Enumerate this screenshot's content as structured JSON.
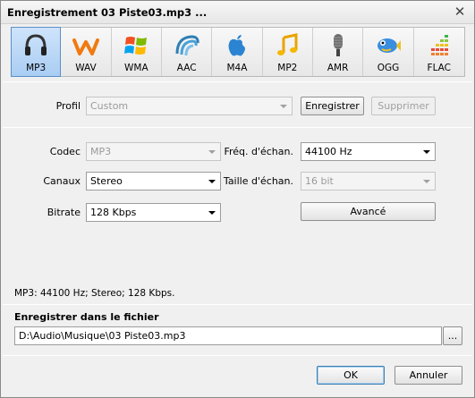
{
  "window": {
    "title": "Enregistrement 03 Piste03.mp3 ...",
    "close_glyph": "✕"
  },
  "formats": [
    {
      "label": "MP3",
      "icon": "headphones-icon",
      "selected": true
    },
    {
      "label": "WAV",
      "icon": "wave-icon",
      "selected": false
    },
    {
      "label": "WMA",
      "icon": "windows-flag-icon",
      "selected": false
    },
    {
      "label": "AAC",
      "icon": "aac-swirl-icon",
      "selected": false
    },
    {
      "label": "M4A",
      "icon": "apple-icon",
      "selected": false
    },
    {
      "label": "MP2",
      "icon": "music-note-icon",
      "selected": false
    },
    {
      "label": "AMR",
      "icon": "microphone-icon",
      "selected": false
    },
    {
      "label": "OGG",
      "icon": "fish-icon",
      "selected": false
    },
    {
      "label": "FLAC",
      "icon": "equalizer-icon",
      "selected": false
    }
  ],
  "profile": {
    "label": "Profil",
    "value": "Custom",
    "save_label": "Enregistrer",
    "delete_label": "Supprimer"
  },
  "settings": {
    "codec_label": "Codec",
    "codec_value": "MP3",
    "freq_label": "Fréq. d'échan.",
    "freq_value": "44100 Hz",
    "channels_label": "Canaux",
    "channels_value": "Stereo",
    "sample_size_label": "Taille d'échan.",
    "sample_size_value": "16 bit",
    "bitrate_label": "Bitrate",
    "bitrate_value": "128 Kbps",
    "advanced_label": "Avancé"
  },
  "summary": "MP3: 44100  Hz; Stereo; 128 Kbps.",
  "output": {
    "title": "Enregistrer dans le fichier",
    "path": "D:\\Audio\\Musique\\03 Piste03.mp3",
    "browse_label": "..."
  },
  "footer": {
    "ok_label": "OK",
    "cancel_label": "Annuler"
  },
  "colors": {
    "selected_bg": "#a9cdf3",
    "selected_border": "#5b8fc7",
    "default_button_border": "#3c7fb1"
  }
}
